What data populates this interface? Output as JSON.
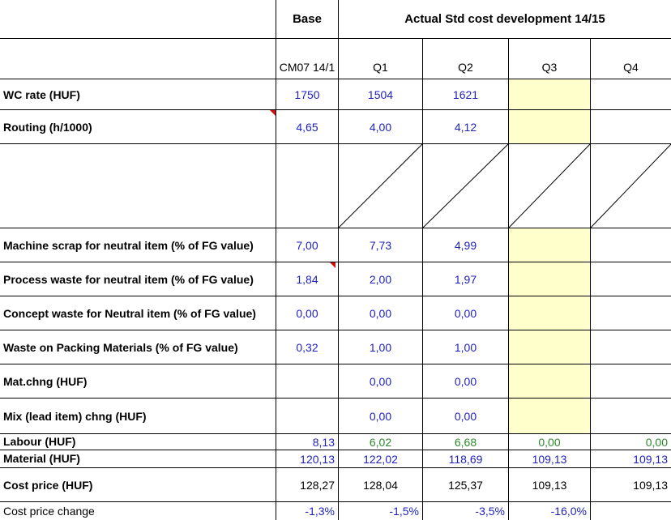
{
  "header": {
    "base": "Base",
    "actual": "Actual Std cost development 14/15",
    "cols": [
      "CM07 14/1",
      "Q1",
      "Q2",
      "Q3",
      "Q4"
    ]
  },
  "rows": {
    "wc_rate": {
      "label": "WC rate (HUF)",
      "vals": [
        "1750",
        "1504",
        "1621",
        "",
        ""
      ]
    },
    "routing": {
      "label": "Routing (h/1000)",
      "vals": [
        "4,65",
        "4,00",
        "4,12",
        "",
        ""
      ]
    },
    "machine_scrap": {
      "label": "Machine scrap for neutral item (% of FG value)",
      "vals": [
        "7,00",
        "7,73",
        "4,99",
        "",
        ""
      ]
    },
    "process_waste": {
      "label": "Process waste for neutral item (% of FG value)",
      "vals": [
        "1,84",
        "2,00",
        "1,97",
        "",
        ""
      ]
    },
    "concept_waste": {
      "label": "Concept waste for Neutral item (% of FG value)",
      "vals": [
        "0,00",
        "0,00",
        "0,00",
        "",
        ""
      ]
    },
    "waste_packing": {
      "label": "Waste on Packing Materials (% of FG value)",
      "vals": [
        "0,32",
        "1,00",
        "1,00",
        "",
        ""
      ]
    },
    "mat_chng": {
      "label": "Mat.chng (HUF)",
      "vals": [
        "",
        "0,00",
        "0,00",
        "",
        ""
      ]
    },
    "mix_chng": {
      "label": "Mix (lead item) chng (HUF)",
      "vals": [
        "",
        "0,00",
        "0,00",
        "",
        ""
      ]
    },
    "labour": {
      "label": "Labour (HUF)",
      "vals": [
        "8,13",
        "6,02",
        "6,68",
        "0,00",
        "0,00"
      ]
    },
    "material": {
      "label": "Material (HUF)",
      "vals": [
        "120,13",
        "122,02",
        "118,69",
        "109,13",
        "109,13"
      ]
    },
    "cost_price": {
      "label": "Cost price (HUF)",
      "vals": [
        "128,27",
        "128,04",
        "125,37",
        "109,13",
        "109,13"
      ]
    },
    "cost_change": {
      "label": "Cost price change",
      "vals": [
        "-1,3%",
        "-1,5%",
        "-3,5%",
        "-16,0%",
        ""
      ]
    }
  },
  "colors": {
    "blue": "#1f1fc0",
    "green": "#2c8a2c",
    "yellow": "#ffffcc",
    "note": "#d01010"
  }
}
